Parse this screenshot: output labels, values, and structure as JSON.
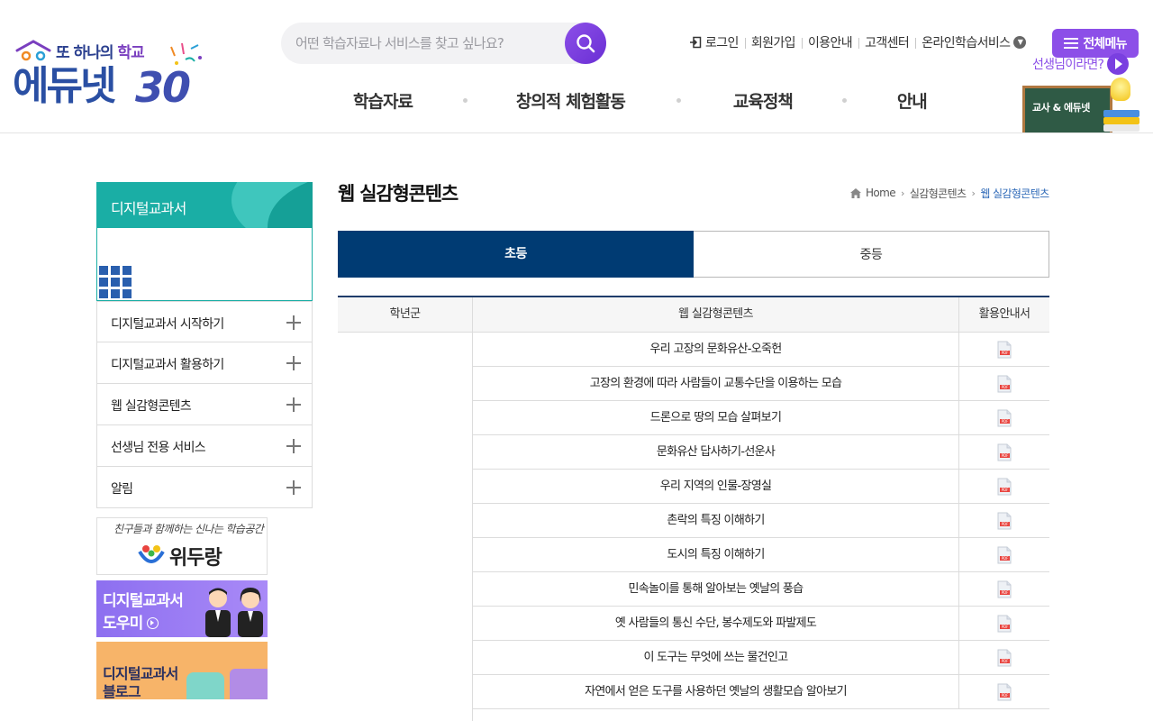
{
  "header": {
    "logo": {
      "tagline_prefix": "또 하나의 ",
      "tagline_highlight": "학교",
      "brand": "에듀넷",
      "anniversary": "30"
    },
    "search": {
      "placeholder": "어떤 학습자료나 서비스를 찾고 싶나요?"
    },
    "util_links": [
      "로그인",
      "회원가입",
      "이용안내",
      "고객센터",
      "온라인학습서비스"
    ],
    "all_menu_label": "전체메뉴",
    "teacher_link": "선생님이라면?",
    "gnb": [
      "학습자료",
      "창의적 체험활동",
      "교육정책",
      "안내"
    ],
    "teacher_banner": "교사 & 에듀넷"
  },
  "sidebar": {
    "title": "디지털교과서",
    "items": [
      "디지털교과서 시작하기",
      "디지털교과서 활용하기",
      "웹 실감형콘텐츠",
      "선생님 전용 서비스",
      "알림"
    ],
    "banners": {
      "widurang": {
        "script": "친구들과 함께하는 신나는 학습공간",
        "name": "위두랑"
      },
      "helper": {
        "line1": "디지털교과서",
        "line2": "도우미"
      },
      "blog": {
        "line1": "디지털교과서",
        "line2": "블로그"
      }
    }
  },
  "main": {
    "title": "웹 실감형콘텐츠",
    "breadcrumb": [
      "Home",
      "실감형콘텐츠",
      "웹 실감형콘텐츠"
    ],
    "tabs": [
      {
        "label": "초등",
        "active": true
      },
      {
        "label": "중등",
        "active": false
      }
    ],
    "table": {
      "headers": [
        "학년군",
        "웹 실감형콘텐츠",
        "활용안내서"
      ],
      "rows": [
        "우리 고장의 문화유산-오죽헌",
        "고장의 환경에 따라 사람들이 교통수단을 이용하는 모습",
        "드론으로 땅의 모습 살펴보기",
        "문화유산 답사하기-선운사",
        "우리 지역의 인물-장영실",
        "촌락의 특징 이해하기",
        "도시의 특징 이해하기",
        "민속놀이를 통해 알아보는 옛날의 풍습",
        "옛 사람들의 통신 수단, 봉수제도와 파발제도",
        "이 도구는 무엇에 쓰는 물건인고",
        "자연에서 얻은 도구를 사용하던 옛날의 생활모습 알아보기"
      ]
    }
  },
  "colors": {
    "accent_purple": "#8c4fe8",
    "tab_active": "#003b73",
    "sidebar_teal": "#1aaea5",
    "table_border": "#1f3d6b"
  },
  "icons": [
    "home-icon",
    "search-icon",
    "login-icon",
    "pdf-icon",
    "plus-icon",
    "menu-icon",
    "play-icon"
  ]
}
